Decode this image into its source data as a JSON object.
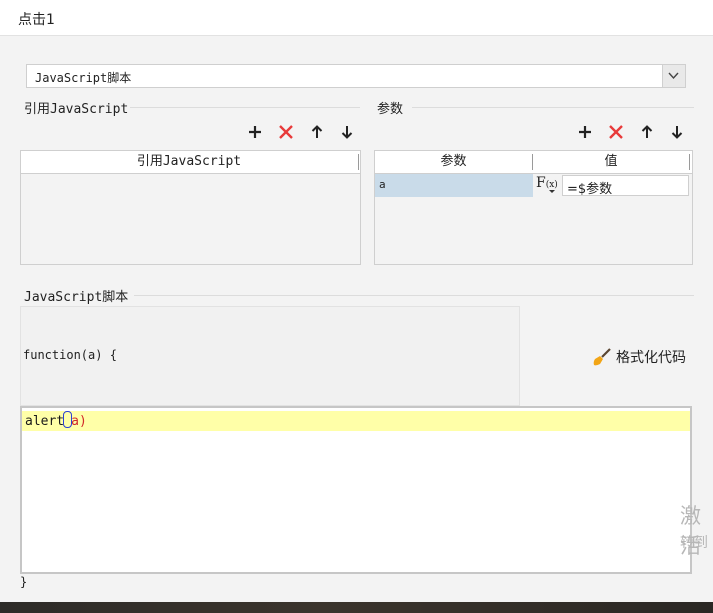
{
  "window": {
    "title": "点击1"
  },
  "script_type": {
    "selected": "JavaScript脚本"
  },
  "ref_js": {
    "section_label": "引用JavaScript",
    "column_header": "引用JavaScript",
    "rows": []
  },
  "params": {
    "section_label": "参数",
    "columns": [
      "参数",
      "值"
    ],
    "rows": [
      {
        "name": "a",
        "formula_icon": "F(x)",
        "value": "=$参数"
      }
    ]
  },
  "script": {
    "section_label": "JavaScript脚本",
    "header_line": "function(a) {",
    "code_before_cursor": "alert",
    "code_paren_open": "(",
    "code_arg": "a",
    "code_paren_close": ")",
    "footer_line": "}",
    "format_label": "格式化代码"
  },
  "watermark": {
    "line1": "激活",
    "line2": "转到"
  },
  "toolbar_icons": [
    "plus-icon",
    "x-icon",
    "arrow-up-icon",
    "arrow-down-icon"
  ],
  "colors": {
    "delete_red": "#e83a3a",
    "selected_row": "#c9dbe9",
    "current_line": "#ffffa8"
  }
}
